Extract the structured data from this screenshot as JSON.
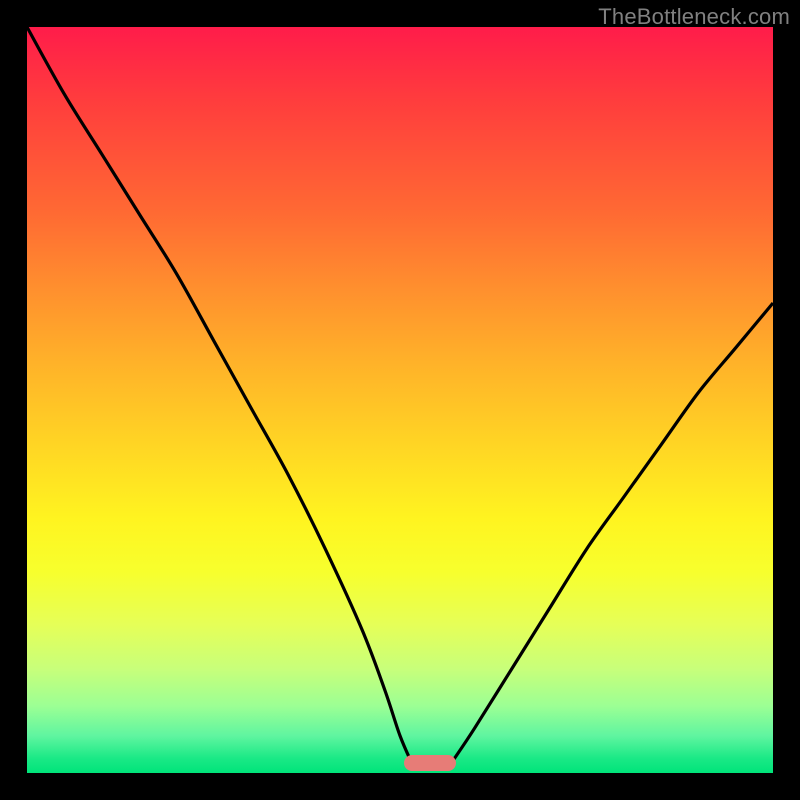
{
  "watermark": "TheBottleneck.com",
  "colors": {
    "frame_bg": "#000000",
    "curve_stroke": "#000000",
    "marker_fill": "#e77c77",
    "gradient_top": "#ff1c4a",
    "gradient_bottom": "#00e47a",
    "watermark_text": "#808080"
  },
  "chart_data": {
    "type": "line",
    "title": "",
    "xlabel": "",
    "ylabel": "",
    "xlim": [
      0,
      100
    ],
    "ylim": [
      0,
      100
    ],
    "grid": false,
    "legend": false,
    "series": [
      {
        "name": "left-branch",
        "x": [
          0,
          5,
          10,
          15,
          20,
          25,
          30,
          35,
          40,
          45,
          48,
          50,
          51.5
        ],
        "values": [
          100,
          91,
          83,
          75,
          67,
          58,
          49,
          40,
          30,
          19,
          11,
          5,
          1.5
        ]
      },
      {
        "name": "right-branch",
        "x": [
          57,
          60,
          65,
          70,
          75,
          80,
          85,
          90,
          95,
          100
        ],
        "values": [
          1.5,
          6,
          14,
          22,
          30,
          37,
          44,
          51,
          57,
          63
        ]
      }
    ],
    "marker": {
      "x_center": 54,
      "y": 1.3,
      "width_x": 7,
      "height_y": 2.2
    }
  }
}
